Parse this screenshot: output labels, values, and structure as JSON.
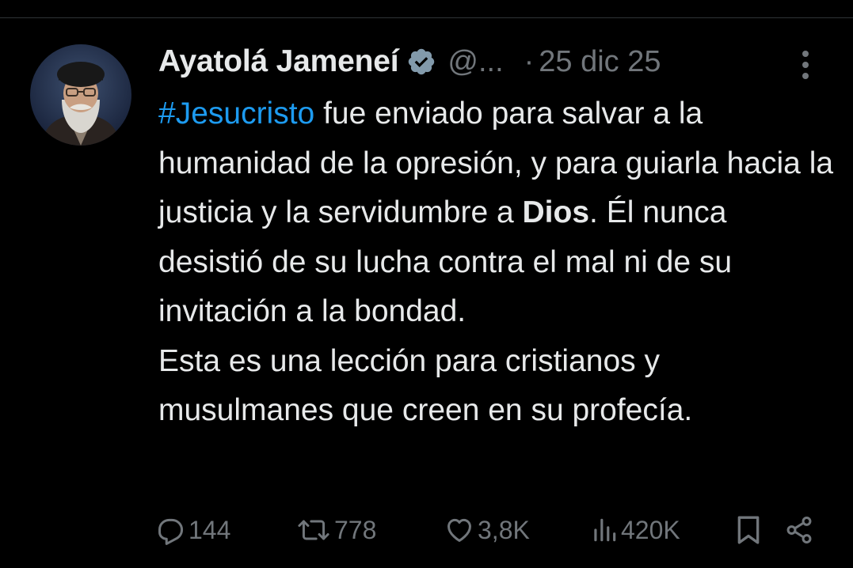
{
  "tweet": {
    "author_name": "Ayatolá Jameneí",
    "handle": "@...",
    "separator": "·",
    "date": "25 dic 25",
    "hashtag": "#Jesucristo",
    "text_1": " fue enviado para salvar a la humanidad de la opresión, y para guiarla hacia la justicia y la servidumbre a ",
    "text_bold": "Dios",
    "text_2": ". Él nunca desistió de su lucha contra el mal ni de su invitación a la bondad.",
    "text_3": "Esta es una lección para cristianos y musulmanes que creen en su profecía."
  },
  "actions": {
    "replies": "144",
    "reposts": "778",
    "likes": "3,8K",
    "views": "420K"
  },
  "icons": {
    "verified": "verified-badge-icon",
    "more": "more-options-icon",
    "reply": "reply-icon",
    "repost": "repost-icon",
    "like": "heart-icon",
    "views": "views-chart-icon",
    "bookmark": "bookmark-icon",
    "share": "share-icon"
  },
  "colors": {
    "background": "#000000",
    "text": "#e7e9ea",
    "secondary": "#71767b",
    "link": "#1d9bf0",
    "verified": "#829aab"
  }
}
